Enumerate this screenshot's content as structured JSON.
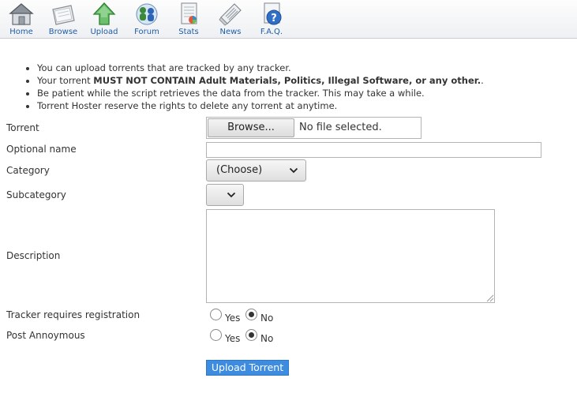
{
  "nav": {
    "items": [
      {
        "label": "Home",
        "icon": "house-icon"
      },
      {
        "label": "Browse",
        "icon": "folder-icon"
      },
      {
        "label": "Upload",
        "icon": "upload-arrow-icon"
      },
      {
        "label": "Forum",
        "icon": "forum-people-icon"
      },
      {
        "label": "Stats",
        "icon": "stats-sheet-icon"
      },
      {
        "label": "News",
        "icon": "newspaper-icon"
      },
      {
        "label": "F.A.Q.",
        "icon": "faq-question-icon"
      }
    ]
  },
  "rules": {
    "line1": "You can upload torrents that are tracked by any tracker.",
    "line2_prefix": "Your torrent ",
    "line2_bold": "MUST NOT CONTAIN Adult Materials, Politics, Illegal Software, or any other.",
    "line2_suffix": ".",
    "line3": "Be patient while the script retrieves the data from the tracker. This may take a while.",
    "line4": "Torrent Hoster reserve the rights to delete any torrent at anytime."
  },
  "form": {
    "torrent_label": "Torrent",
    "browse_label": "Browse...",
    "file_status": "No file selected.",
    "optional_name_label": "Optional name",
    "optional_name_value": "",
    "category_label": "Category",
    "category_selected": "(Choose)",
    "subcategory_label": "Subcategory",
    "subcategory_selected": "",
    "description_label": "Description",
    "description_value": "",
    "tracker_reg_label": "Tracker requires registration",
    "post_anon_label": "Post Annoymous",
    "yes_label": "Yes",
    "no_label": "No",
    "tracker_reg_selected": "No",
    "post_anon_selected": "No",
    "submit_label": "Upload Torrent"
  },
  "colors": {
    "nav_link": "#1f5da8",
    "submit_bg": "#3d8ce0",
    "upload_green": "#3c9a3c"
  }
}
